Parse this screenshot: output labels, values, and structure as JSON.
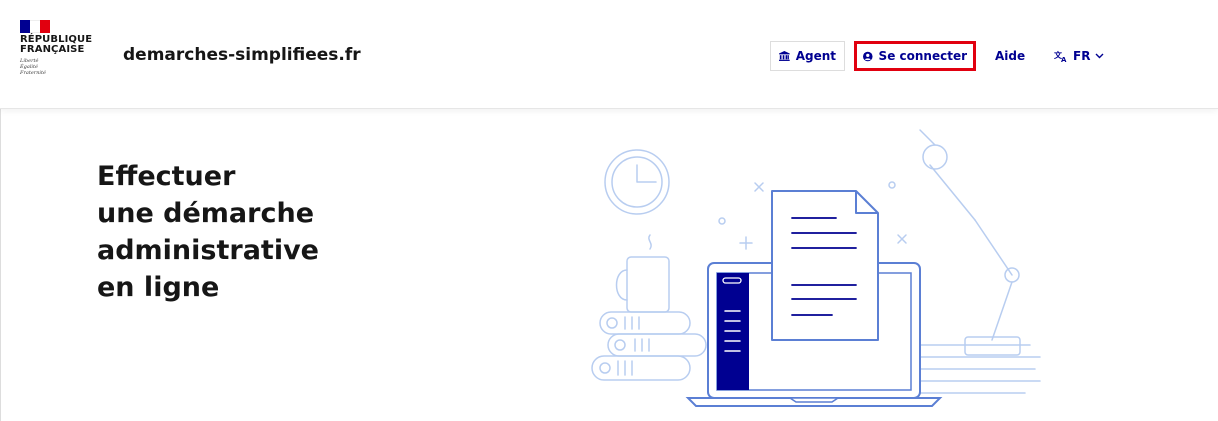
{
  "header": {
    "logo": {
      "title": "RÉPUBLIQUE\nFRANÇAISE",
      "motto": "Liberté\nÉgalité\nFraternité",
      "flag_colors": [
        "#000091",
        "#ffffff",
        "#e1000f"
      ]
    },
    "site_name": "demarches-simplifiees.fr",
    "nav": {
      "agent_label": "Agent",
      "agent_icon": "government-building-icon",
      "connect_label": "Se connecter",
      "connect_icon": "user-circle-icon",
      "aide_label": "Aide",
      "lang_label": "FR",
      "lang_icon": "translate-icon"
    }
  },
  "hero": {
    "title_lines": [
      "Effectuer",
      "une démarche",
      "administrative",
      "en ligne"
    ]
  },
  "colors": {
    "primary": "#000091",
    "highlight": "#e1000f",
    "illustration_line": "#b8cdf0",
    "illustration_dark": "#000091"
  }
}
